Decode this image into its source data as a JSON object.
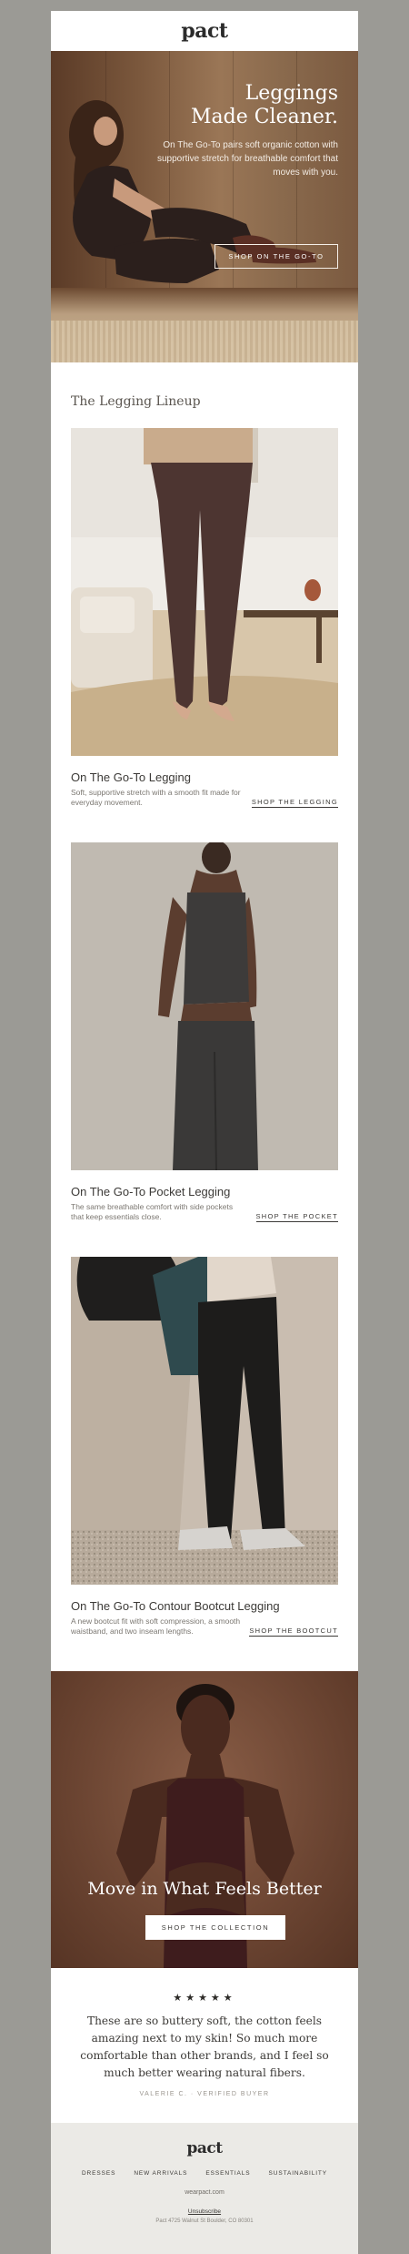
{
  "header": {
    "logo": "pact"
  },
  "hero": {
    "title_line1": "Leggings",
    "title_line2": "Made Cleaner.",
    "body": "On The Go-To pairs soft organic cotton with supportive stretch for breathable comfort that moves with you.",
    "cta": "SHOP ON THE GO-TO"
  },
  "lineup": {
    "title": "The Legging Lineup"
  },
  "products": [
    {
      "name": "On The Go-To Legging",
      "description": "Soft, supportive stretch with a smooth fit made for everyday movement.",
      "cta": "SHOP THE LEGGING"
    },
    {
      "name": "On The Go-To Pocket Legging",
      "description": "The same breathable comfort with side pockets that keep essentials close.",
      "cta": "SHOP THE POCKET"
    },
    {
      "name": "On The Go-To Contour Bootcut Legging",
      "description": "A new bootcut fit with soft compression, a smooth waistband, and two inseam lengths.",
      "cta": "SHOP THE BOOTCUT"
    }
  ],
  "banner": {
    "title": "Move in What Feels Better",
    "cta": "SHOP THE COLLECTION"
  },
  "review": {
    "stars": "★★★★★",
    "quote": "These are so buttery soft, the cotton feels amazing next to my skin! So much more comfortable than other brands, and I feel so much better wearing natural fibers.",
    "reviewer": "VALERIE C. · VERIFIED BUYER"
  },
  "footer": {
    "logo": "pact",
    "nav": [
      "DRESSES",
      "NEW ARRIVALS",
      "ESSENTIALS",
      "SUSTAINABILITY"
    ],
    "website": "wearpact.com",
    "unsubscribe": "Unsubscribe",
    "address": "Pact 4725 Walnut St Boulder, CO 80301"
  },
  "colors": {
    "page_background": "#9b9a95",
    "hero_brown": "#7a573c",
    "banner_brown": "#6d4633",
    "footer_background": "#ebeae6",
    "text_dark": "#3c3a37"
  }
}
